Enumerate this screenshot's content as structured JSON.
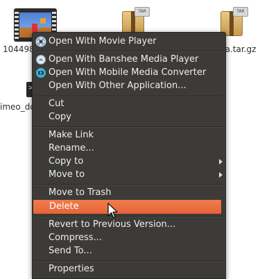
{
  "desktop": {
    "files": [
      {
        "label": "104498",
        "icon": "video-file-icon"
      },
      {
        "label": "",
        "icon": "archive-icon"
      },
      {
        "label": "ca.tar.gz",
        "icon": "archive-icon"
      },
      {
        "label": "imeo_do",
        "icon": "terminal-icon"
      }
    ],
    "archive_tag": "TAR"
  },
  "context_menu": {
    "items": [
      {
        "label": "Open With Movie Player",
        "icon": "movie-player-icon"
      },
      {
        "label": "Open With Banshee Media Player",
        "icon": "banshee-icon"
      },
      {
        "label": "Open With Mobile Media Converter",
        "icon": "media-converter-icon"
      },
      {
        "label": "Open With Other Application..."
      },
      {
        "label": "Cut"
      },
      {
        "label": "Copy"
      },
      {
        "label": "Make Link"
      },
      {
        "label": "Rename..."
      },
      {
        "label": "Copy to",
        "submenu": true
      },
      {
        "label": "Move to",
        "submenu": true
      },
      {
        "label": "Move to Trash"
      },
      {
        "label": "Delete",
        "highlighted": true
      },
      {
        "label": "Revert to Previous Version..."
      },
      {
        "label": "Compress..."
      },
      {
        "label": "Send To..."
      },
      {
        "label": "Properties"
      }
    ]
  },
  "colors": {
    "menu_bg": "#3c3b37",
    "menu_text": "#eeeeee",
    "highlight": "#e9653b"
  }
}
